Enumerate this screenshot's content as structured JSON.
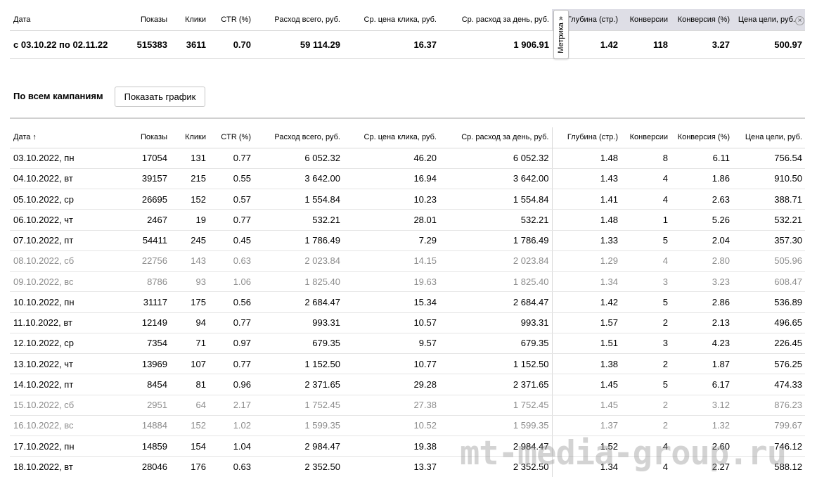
{
  "columns": [
    "Дата",
    "Показы",
    "Клики",
    "CTR (%)",
    "Расход всего, руб.",
    "Ср. цена клика, руб.",
    "Ср. расход за день, руб.",
    "Глубина (стр.)",
    "Конверсии",
    "Конверсия (%)",
    "Цена цели, руб."
  ],
  "data_date_header": "Дата ↑",
  "summary": {
    "period": "с 03.10.22 по 02.11.22",
    "values": [
      "515383",
      "3611",
      "0.70",
      "59 114.29",
      "16.37",
      "1 906.91",
      "1.42",
      "118",
      "3.27",
      "500.97"
    ]
  },
  "metrika_toggle_label": "Метрика »",
  "close_glyph": "×",
  "section_title": "По всем кампаниям",
  "show_chart_label": "Показать график",
  "rows": [
    [
      "03.10.2022, пн",
      "17054",
      "131",
      "0.77",
      "6 052.32",
      "46.20",
      "6 052.32",
      "1.48",
      "8",
      "6.11",
      "756.54"
    ],
    [
      "04.10.2022, вт",
      "39157",
      "215",
      "0.55",
      "3 642.00",
      "16.94",
      "3 642.00",
      "1.43",
      "4",
      "1.86",
      "910.50"
    ],
    [
      "05.10.2022, ср",
      "26695",
      "152",
      "0.57",
      "1 554.84",
      "10.23",
      "1 554.84",
      "1.41",
      "4",
      "2.63",
      "388.71"
    ],
    [
      "06.10.2022, чт",
      "2467",
      "19",
      "0.77",
      "532.21",
      "28.01",
      "532.21",
      "1.48",
      "1",
      "5.26",
      "532.21"
    ],
    [
      "07.10.2022, пт",
      "54411",
      "245",
      "0.45",
      "1 786.49",
      "7.29",
      "1 786.49",
      "1.33",
      "5",
      "2.04",
      "357.30"
    ],
    [
      "08.10.2022, сб",
      "22756",
      "143",
      "0.63",
      "2 023.84",
      "14.15",
      "2 023.84",
      "1.29",
      "4",
      "2.80",
      "505.96"
    ],
    [
      "09.10.2022, вс",
      "8786",
      "93",
      "1.06",
      "1 825.40",
      "19.63",
      "1 825.40",
      "1.34",
      "3",
      "3.23",
      "608.47"
    ],
    [
      "10.10.2022, пн",
      "31117",
      "175",
      "0.56",
      "2 684.47",
      "15.34",
      "2 684.47",
      "1.42",
      "5",
      "2.86",
      "536.89"
    ],
    [
      "11.10.2022, вт",
      "12149",
      "94",
      "0.77",
      "993.31",
      "10.57",
      "993.31",
      "1.57",
      "2",
      "2.13",
      "496.65"
    ],
    [
      "12.10.2022, ср",
      "7354",
      "71",
      "0.97",
      "679.35",
      "9.57",
      "679.35",
      "1.51",
      "3",
      "4.23",
      "226.45"
    ],
    [
      "13.10.2022, чт",
      "13969",
      "107",
      "0.77",
      "1 152.50",
      "10.77",
      "1 152.50",
      "1.38",
      "2",
      "1.87",
      "576.25"
    ],
    [
      "14.10.2022, пт",
      "8454",
      "81",
      "0.96",
      "2 371.65",
      "29.28",
      "2 371.65",
      "1.45",
      "5",
      "6.17",
      "474.33"
    ],
    [
      "15.10.2022, сб",
      "2951",
      "64",
      "2.17",
      "1 752.45",
      "27.38",
      "1 752.45",
      "1.45",
      "2",
      "3.12",
      "876.23"
    ],
    [
      "16.10.2022, вс",
      "14884",
      "152",
      "1.02",
      "1 599.35",
      "10.52",
      "1 599.35",
      "1.37",
      "2",
      "1.32",
      "799.67"
    ],
    [
      "17.10.2022, пн",
      "14859",
      "154",
      "1.04",
      "2 984.47",
      "19.38",
      "2 984.47",
      "1.52",
      "4",
      "2.60",
      "746.12"
    ],
    [
      "18.10.2022, вт",
      "28046",
      "176",
      "0.63",
      "2 352.50",
      "13.37",
      "2 352.50",
      "1.34",
      "4",
      "2.27",
      "588.12"
    ]
  ],
  "weekend_rows": [
    5,
    6,
    12,
    13
  ],
  "watermark": "mt-media-group.ru",
  "colors": {
    "metrika_header_bg": "#dedee6",
    "weekend_text": "#8c8c8c",
    "border": "#d9d9d9"
  }
}
